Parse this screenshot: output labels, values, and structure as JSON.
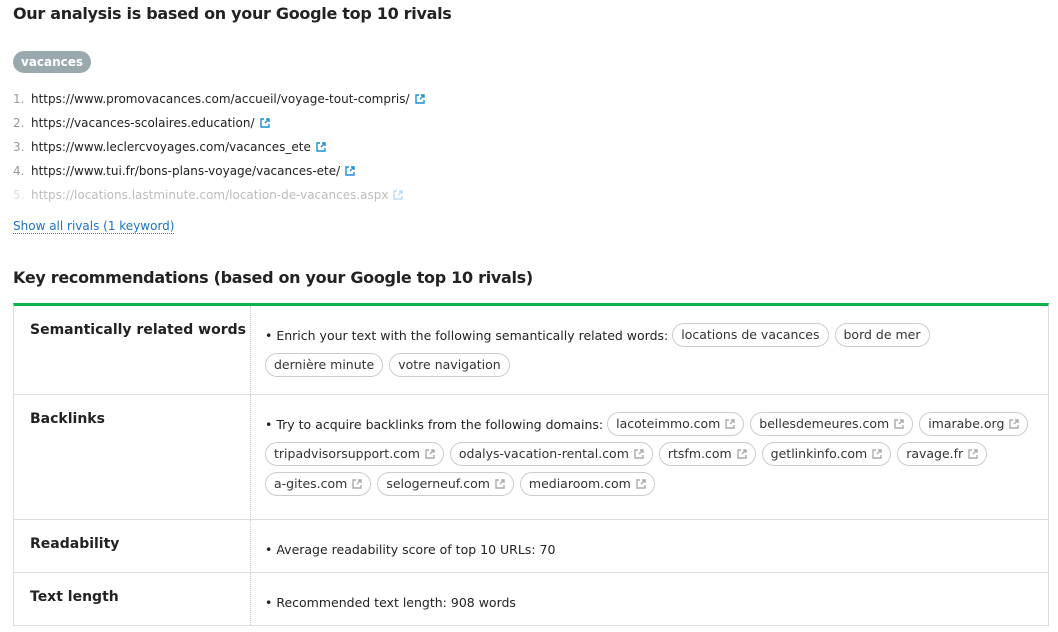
{
  "rivals": {
    "title": "Our analysis is based on your Google top 10 rivals",
    "keyword": "vacances",
    "urls": [
      "https://www.promovacances.com/accueil/voyage-tout-compris/",
      "https://vacances-scolaires.education/",
      "https://www.leclercvoyages.com/vacances_ete",
      "https://www.tui.fr/bons-plans-voyage/vacances-ete/",
      "https://locations.lastminute.com/location-de-vacances.aspx"
    ],
    "show_all": "Show all rivals (1 keyword)"
  },
  "recs": {
    "title": "Key recommendations (based on your Google top 10 rivals)",
    "accent": "#0bb34b",
    "semantic": {
      "label": "Semantically related words",
      "text": "• Enrich your text with the following semantically related words:",
      "words": [
        "locations de vacances",
        "bord de mer",
        "dernière minute",
        "votre navigation"
      ]
    },
    "backlinks": {
      "label": "Backlinks",
      "text": "• Try to acquire backlinks from the following domains:",
      "domains": [
        "lacoteimmo.com",
        "bellesdemeures.com",
        "imarabe.org",
        "tripadvisorsupport.com",
        "odalys-vacation-rental.com",
        "rtsfm.com",
        "getlinkinfo.com",
        "ravage.fr",
        "a-gites.com",
        "selogerneuf.com",
        "mediaroom.com"
      ]
    },
    "readability": {
      "label": "Readability",
      "text": "• Average readability score of top 10 URLs:",
      "value": "70"
    },
    "length": {
      "label": "Text length",
      "text": "• Recommended text length:",
      "value": "908 words"
    }
  }
}
